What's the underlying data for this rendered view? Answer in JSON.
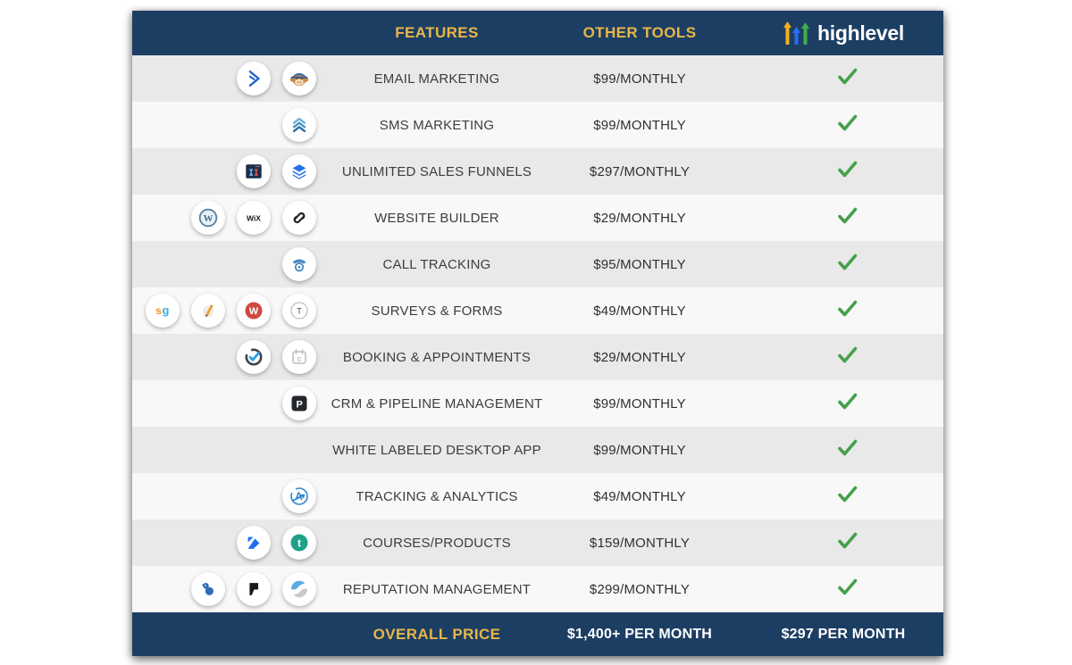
{
  "header": {
    "features_label": "FEATURES",
    "other_tools_label": "OTHER TOOLS",
    "brand_name": "highlevel"
  },
  "colors": {
    "navy": "#1c3e63",
    "gold": "#e9b646",
    "check_green": "#45a049",
    "row_gray": "#e8e9e8",
    "row_light": "#f7f8f7",
    "logo_yellow": "#f2b01e",
    "logo_blue": "#2a6df5",
    "logo_green": "#3fae49"
  },
  "rows": [
    {
      "feature": "EMAIL MARKETING",
      "other_price": "$99/MONTHLY",
      "highlevel_included": true,
      "icons": [
        "activecampaign-icon",
        "mailchimp-icon"
      ]
    },
    {
      "feature": "SMS MARKETING",
      "other_price": "$99/MONTHLY",
      "highlevel_included": true,
      "icons": [
        "sms-chevrons-icon"
      ]
    },
    {
      "feature": "UNLIMITED SALES FUNNELS",
      "other_price": "$297/MONTHLY",
      "highlevel_included": true,
      "icons": [
        "clickfunnels-icon",
        "layers-icon"
      ]
    },
    {
      "feature": "WEBSITE BUILDER",
      "other_price": "$29/MONTHLY",
      "highlevel_included": true,
      "icons": [
        "wordpress-icon",
        "wix-icon",
        "squarespace-icon"
      ]
    },
    {
      "feature": "CALL TRACKING",
      "other_price": "$95/MONTHLY",
      "highlevel_included": true,
      "icons": [
        "phone-dial-icon"
      ]
    },
    {
      "feature": "SURVEYS & FORMS",
      "other_price": "$49/MONTHLY",
      "highlevel_included": true,
      "icons": [
        "surveygizmo-icon",
        "pencil-icon",
        "wufoo-icon",
        "typeform-icon"
      ]
    },
    {
      "feature": "BOOKING & APPOINTMENTS",
      "other_price": "$29/MONTHLY",
      "highlevel_included": true,
      "icons": [
        "check-circle-icon",
        "calendar-icon"
      ]
    },
    {
      "feature": "CRM & PIPELINE MANAGEMENT",
      "other_price": "$99/MONTHLY",
      "highlevel_included": true,
      "icons": [
        "pipedrive-icon"
      ]
    },
    {
      "feature": "WHITE LABELED DESKTOP APP",
      "other_price": "$99/MONTHLY",
      "highlevel_included": true,
      "icons": []
    },
    {
      "feature": "TRACKING & ANALYTICS",
      "other_price": "$49/MONTHLY",
      "highlevel_included": true,
      "icons": [
        "analytics-a-icon"
      ]
    },
    {
      "feature": "COURSES/PRODUCTS",
      "other_price": "$159/MONTHLY",
      "highlevel_included": true,
      "icons": [
        "kajabi-icon",
        "teachable-icon"
      ]
    },
    {
      "feature": "REPUTATION MANAGEMENT",
      "other_price": "$299/MONTHLY",
      "highlevel_included": true,
      "icons": [
        "birdeye-icon",
        "podium-flag-icon",
        "swirl-icon"
      ]
    }
  ],
  "footer": {
    "label": "OVERALL PRICE",
    "other_total": "$1,400+ PER MONTH",
    "highlevel_total": "$297 PER MONTH"
  },
  "chart_data": {
    "type": "table",
    "title": "Other tools vs highlevel price comparison",
    "columns": [
      "FEATURES",
      "OTHER TOOLS",
      "HIGHLEVEL"
    ],
    "rows": [
      [
        "EMAIL MARKETING",
        "$99/MONTHLY",
        "included"
      ],
      [
        "SMS MARKETING",
        "$99/MONTHLY",
        "included"
      ],
      [
        "UNLIMITED SALES FUNNELS",
        "$297/MONTHLY",
        "included"
      ],
      [
        "WEBSITE BUILDER",
        "$29/MONTHLY",
        "included"
      ],
      [
        "CALL TRACKING",
        "$95/MONTHLY",
        "included"
      ],
      [
        "SURVEYS & FORMS",
        "$49/MONTHLY",
        "included"
      ],
      [
        "BOOKING & APPOINTMENTS",
        "$29/MONTHLY",
        "included"
      ],
      [
        "CRM & PIPELINE MANAGEMENT",
        "$99/MONTHLY",
        "included"
      ],
      [
        "WHITE LABELED DESKTOP APP",
        "$99/MONTHLY",
        "included"
      ],
      [
        "TRACKING & ANALYTICS",
        "$49/MONTHLY",
        "included"
      ],
      [
        "COURSES/PRODUCTS",
        "$159/MONTHLY",
        "included"
      ],
      [
        "REPUTATION MANAGEMENT",
        "$299/MONTHLY",
        "included"
      ]
    ],
    "summary_row": [
      "OVERALL PRICE",
      "$1,400+ PER MONTH",
      "$297 PER MONTH"
    ]
  }
}
